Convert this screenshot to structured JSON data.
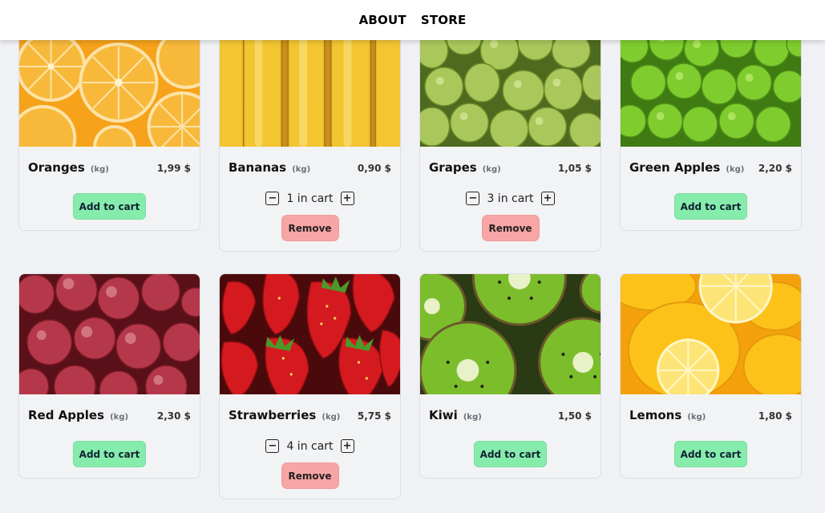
{
  "nav": {
    "about": "ABOUT",
    "store": "STORE"
  },
  "labels": {
    "add_to_cart": "Add to cart",
    "remove": "Remove",
    "unit": "(kg)"
  },
  "products": [
    {
      "name": "Oranges",
      "unit": "(kg)",
      "price": "1,99 $",
      "in_cart": null
    },
    {
      "name": "Bananas",
      "unit": "(kg)",
      "price": "0,90 $",
      "in_cart": "1 in cart"
    },
    {
      "name": "Grapes",
      "unit": "(kg)",
      "price": "1,05 $",
      "in_cart": "3 in cart"
    },
    {
      "name": "Green Apples",
      "unit": "(kg)",
      "price": "2,20 $",
      "in_cart": null
    },
    {
      "name": "Red Apples",
      "unit": "(kg)",
      "price": "2,30 $",
      "in_cart": null
    },
    {
      "name": "Strawberries",
      "unit": "(kg)",
      "price": "5,75 $",
      "in_cart": "4 in cart"
    },
    {
      "name": "Kiwi",
      "unit": "(kg)",
      "price": "1,50 $",
      "in_cart": null
    },
    {
      "name": "Lemons",
      "unit": "(kg)",
      "price": "1,80 $",
      "in_cart": null
    }
  ],
  "icons": {
    "decrease": "minus-square-icon",
    "increase": "plus-square-icon"
  },
  "colors": {
    "add_button": "#86ecac",
    "remove_button": "#f8a5a5",
    "background": "#f0f1f4"
  }
}
